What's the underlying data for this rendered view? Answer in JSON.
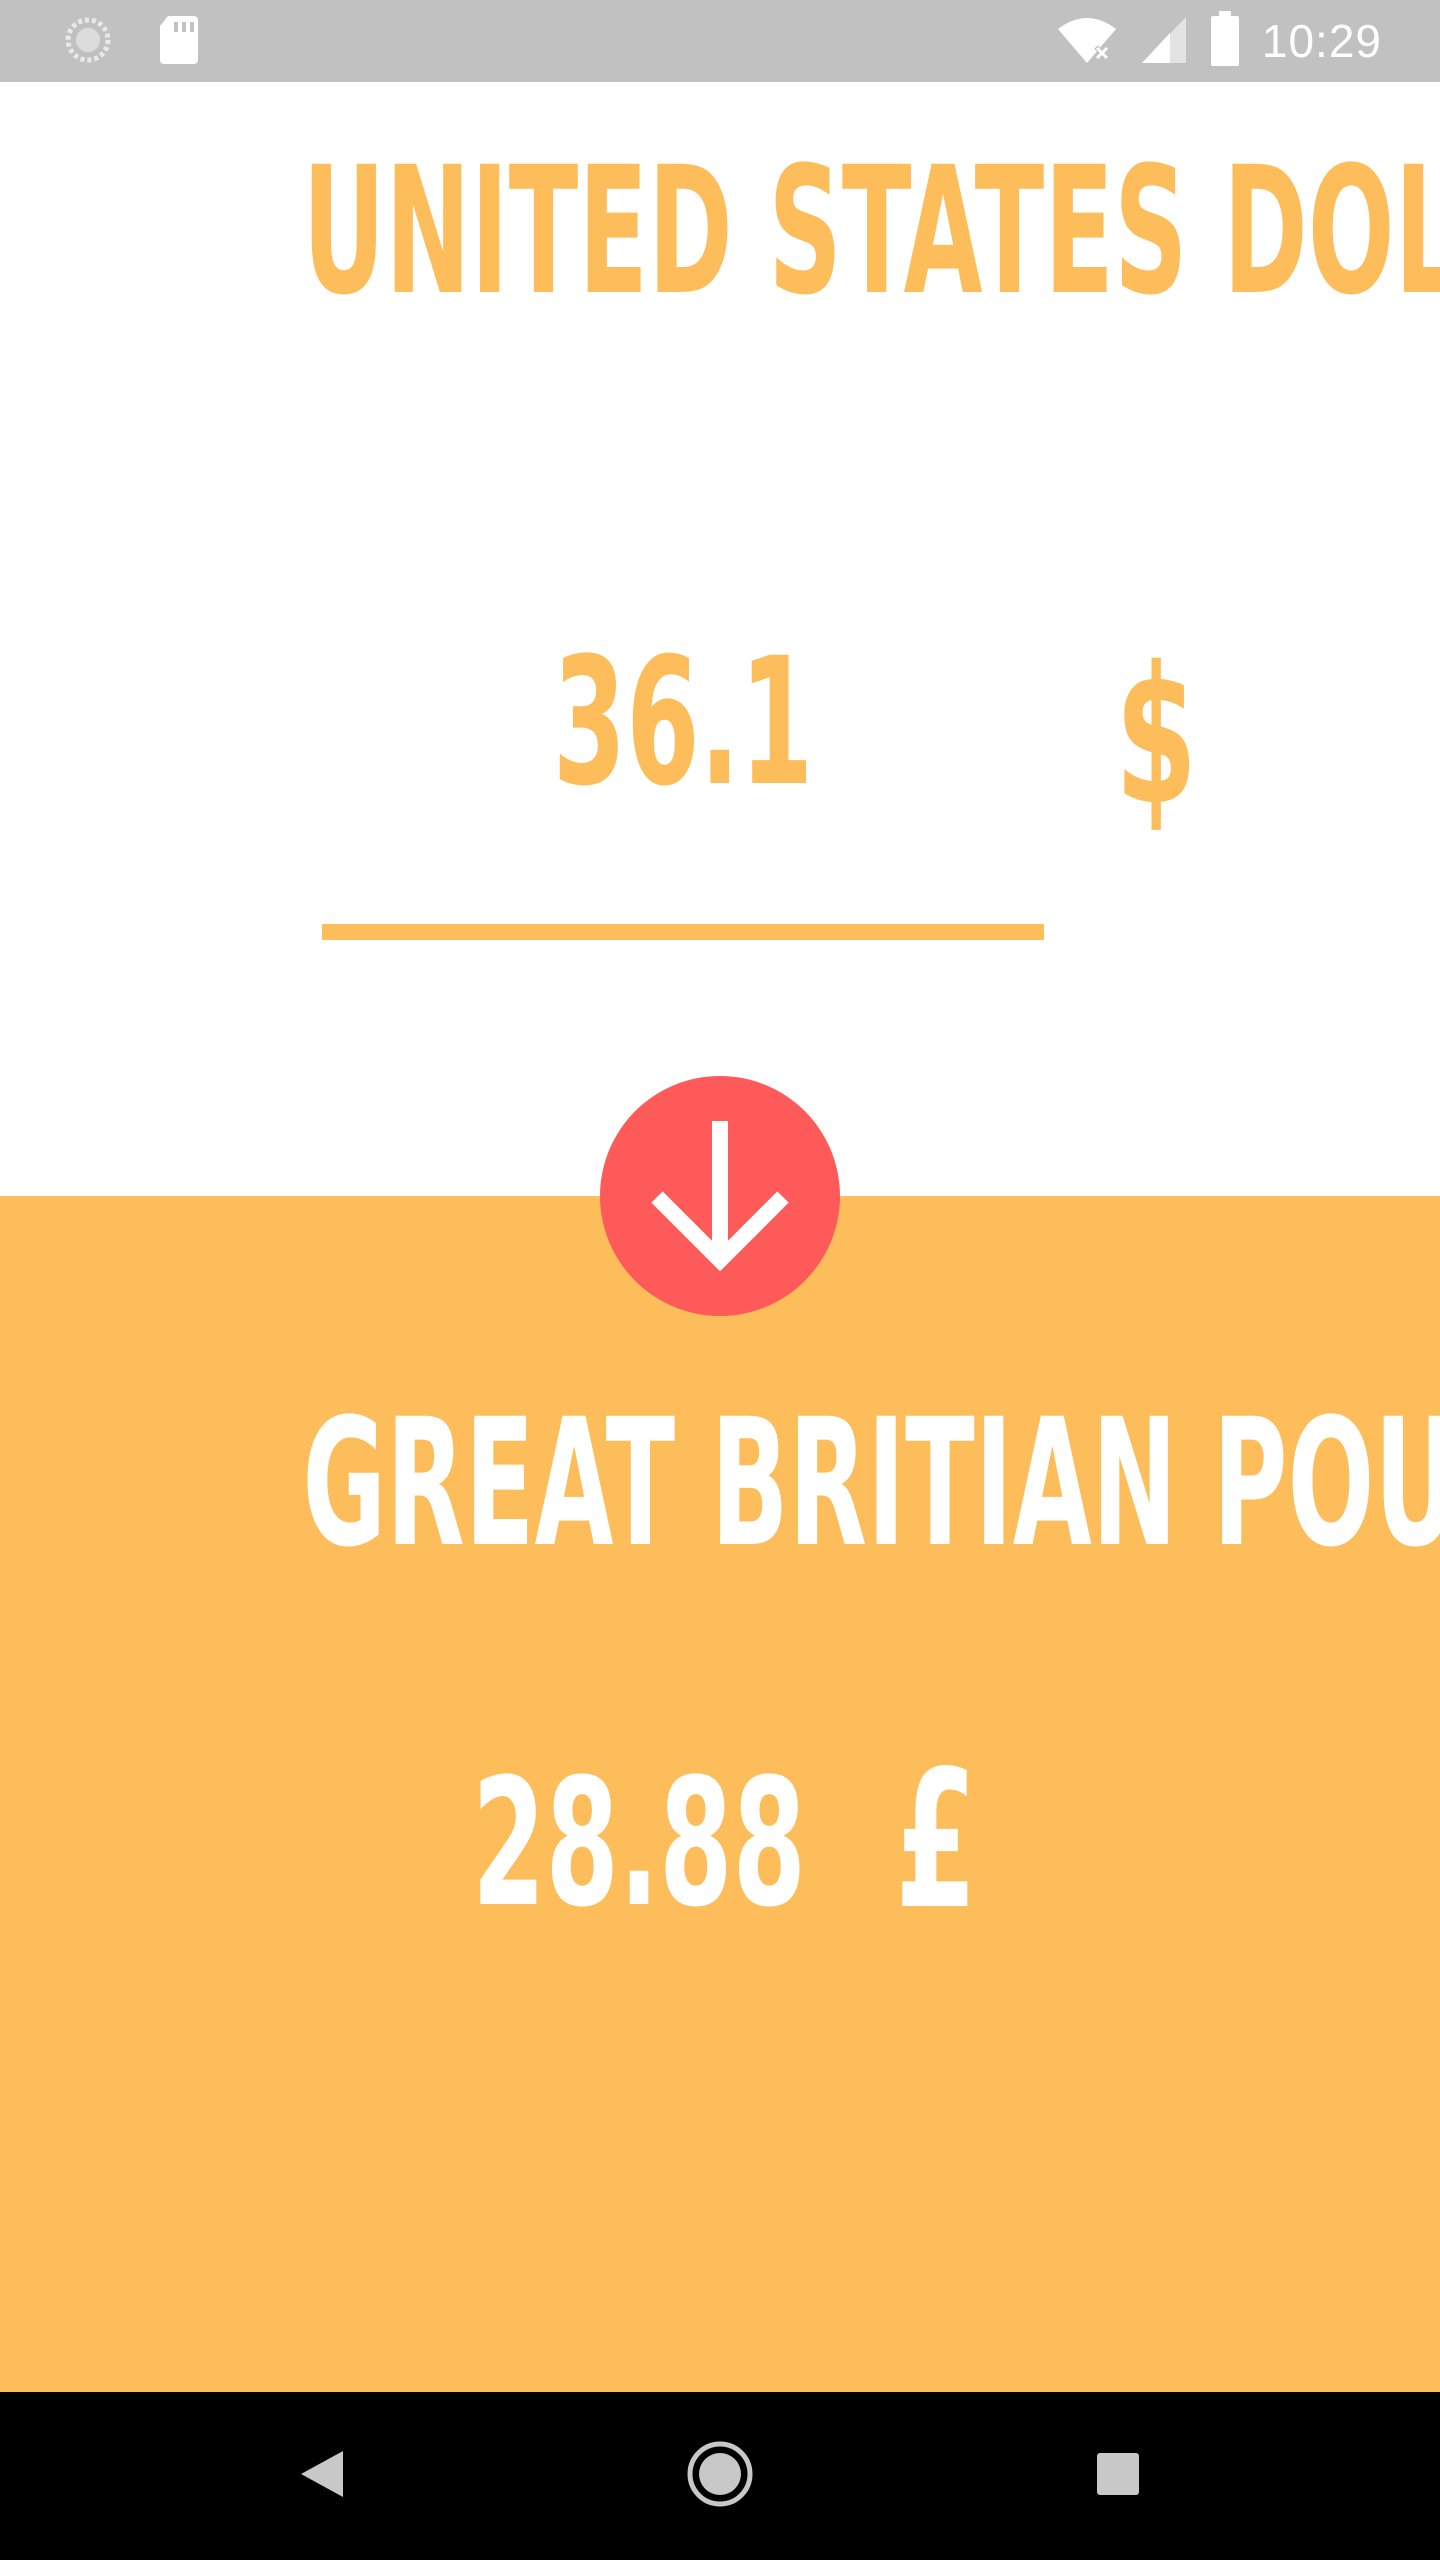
{
  "status_bar": {
    "time": "10:29",
    "icons": [
      "loading-icon",
      "sd-card-icon",
      "wifi-off-icon",
      "signal-icon",
      "battery-icon"
    ]
  },
  "source": {
    "currency_name": "UNITED STATES DOLLAR",
    "amount": "36.1",
    "symbol": "$"
  },
  "swap": {
    "icon": "arrow-down-icon"
  },
  "target": {
    "currency_name": "GREAT BRITIAN POUND",
    "amount": "28.88",
    "symbol": "£"
  },
  "colors": {
    "accent": "#fdbd5a",
    "swap_button": "#ff5a5a",
    "status_bar": "#c1c1c1",
    "nav_bar": "#000000"
  },
  "nav_bar": {
    "icons": [
      "back-icon",
      "home-icon",
      "recents-icon"
    ]
  }
}
